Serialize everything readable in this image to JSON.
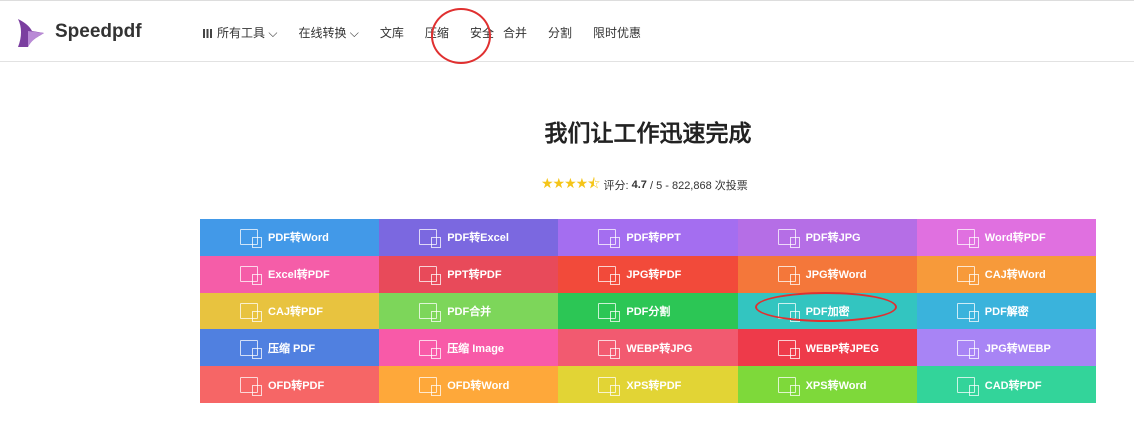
{
  "header": {
    "brand": "Speedpdf",
    "nav": [
      "所有工具",
      "在线转换",
      "文库",
      "压缩",
      "安全",
      "合并",
      "分割",
      "限时优惠"
    ]
  },
  "hero": {
    "title": "我们让工作迅速完成",
    "rating_label": "评分:",
    "rating_value": "4.7",
    "rating_rest": "/ 5 - 822,868 次投票",
    "rating_fraction": 0.94
  },
  "tools": [
    {
      "label": "PDF转Word",
      "color": "#4299e8"
    },
    {
      "label": "PDF转Excel",
      "color": "#7b68e0"
    },
    {
      "label": "PDF转PPT",
      "color": "#a46ef0"
    },
    {
      "label": "PDF转JPG",
      "color": "#b56ee6"
    },
    {
      "label": "Word转PDF",
      "color": "#e070e0"
    },
    {
      "label": "Excel转PDF",
      "color": "#f55da8"
    },
    {
      "label": "PPT转PDF",
      "color": "#e84a5a"
    },
    {
      "label": "JPG转PDF",
      "color": "#f24a3a"
    },
    {
      "label": "JPG转Word",
      "color": "#f4773a"
    },
    {
      "label": "CAJ转Word",
      "color": "#f79a3a"
    },
    {
      "label": "CAJ转PDF",
      "color": "#e8c33f"
    },
    {
      "label": "PDF合并",
      "color": "#7dd65a"
    },
    {
      "label": "PDF分割",
      "color": "#2cc655"
    },
    {
      "label": "PDF加密",
      "color": "#33c5c0"
    },
    {
      "label": "PDF解密",
      "color": "#3ab3dc"
    },
    {
      "label": "压缩 PDF",
      "color": "#5080e0"
    },
    {
      "label": "压缩 Image",
      "color": "#f85aa8"
    },
    {
      "label": "WEBP转JPG",
      "color": "#f25a70"
    },
    {
      "label": "WEBP转JPEG",
      "color": "#ee3a4a"
    },
    {
      "label": "JPG转WEBP",
      "color": "#a884f5"
    },
    {
      "label": "OFD转PDF",
      "color": "#f66666"
    },
    {
      "label": "OFD转Word",
      "color": "#fea83a"
    },
    {
      "label": "XPS转PDF",
      "color": "#e2d435"
    },
    {
      "label": "XPS转Word",
      "color": "#7ed93a"
    },
    {
      "label": "CAD转PDF",
      "color": "#33d49a"
    }
  ]
}
